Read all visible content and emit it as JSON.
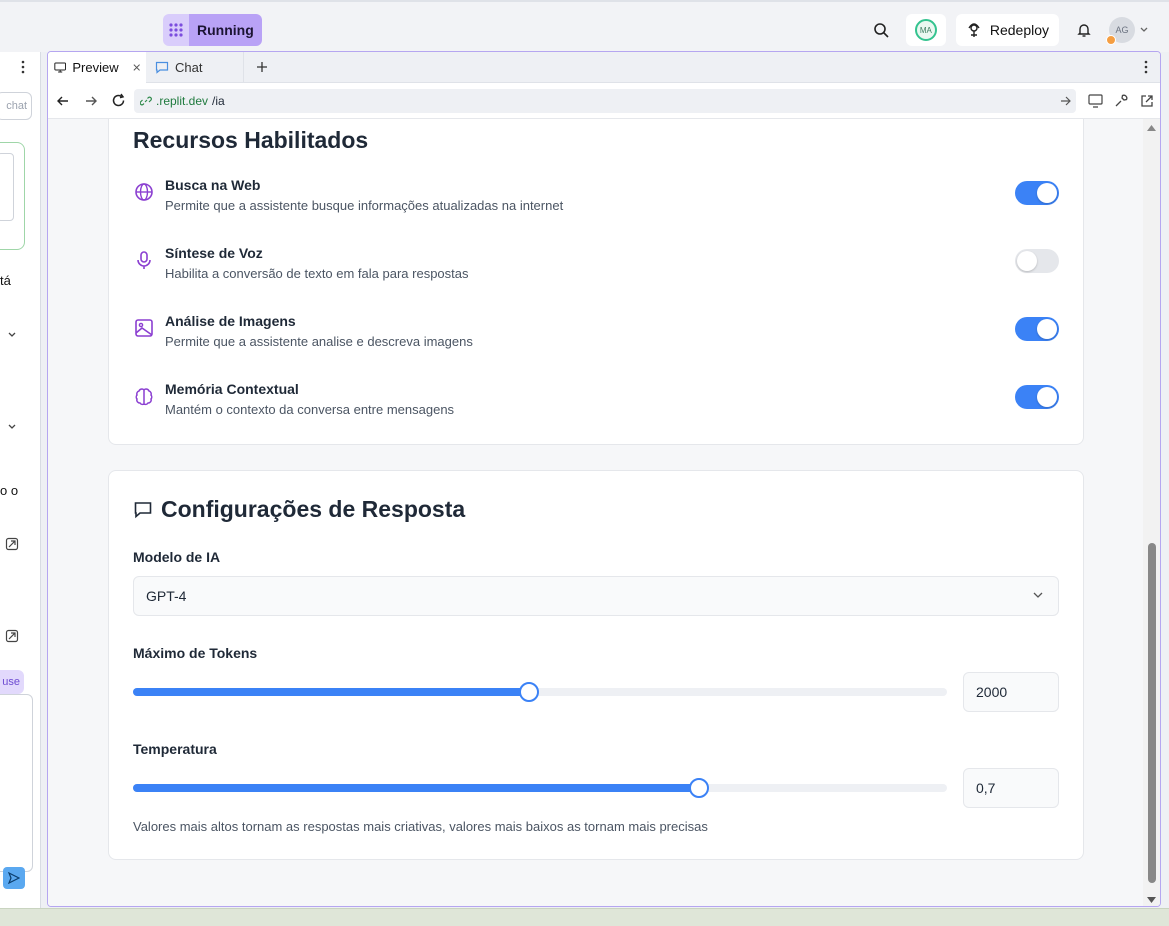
{
  "topbar": {
    "status_label": "Running",
    "ma_avatar": "MA",
    "redeploy_label": "Redeploy",
    "user_avatar": "AG"
  },
  "left_panel": {
    "chat_button": "chat",
    "text_fragment_1": "tá",
    "text_fragment_2": "o o",
    "pause_label": "use"
  },
  "tabs": [
    {
      "label": "Preview"
    },
    {
      "label": "Chat"
    }
  ],
  "address": {
    "domain": ".replit.dev",
    "path": "/ia"
  },
  "features_card": {
    "title": "Recursos Habilitados",
    "items": [
      {
        "icon": "globe-icon",
        "title": "Busca na Web",
        "description": "Permite que a assistente busque informações atualizadas na internet",
        "enabled": true
      },
      {
        "icon": "microphone-icon",
        "title": "Síntese de Voz",
        "description": "Habilita a conversão de texto em fala para respostas",
        "enabled": false
      },
      {
        "icon": "image-icon",
        "title": "Análise de Imagens",
        "description": "Permite que a assistente analise e descreva imagens",
        "enabled": true
      },
      {
        "icon": "brain-icon",
        "title": "Memória Contextual",
        "description": "Mantém o contexto da conversa entre mensagens",
        "enabled": true
      }
    ]
  },
  "response_card": {
    "title": "Configurações de Resposta",
    "model_label": "Modelo de IA",
    "model_value": "GPT-4",
    "tokens_label": "Máximo de Tokens",
    "tokens_value": "2000",
    "tokens_fraction": 0.487,
    "temperature_label": "Temperatura",
    "temperature_value": "0,7",
    "temperature_fraction": 0.695,
    "hint": "Valores mais altos tornam as respostas mais criativas, valores mais baixos as tornam mais precisas"
  },
  "colors": {
    "accent": "#3b82f6",
    "icon_purple": "#8b3fd1",
    "running_bg": "#b9a2f6"
  }
}
